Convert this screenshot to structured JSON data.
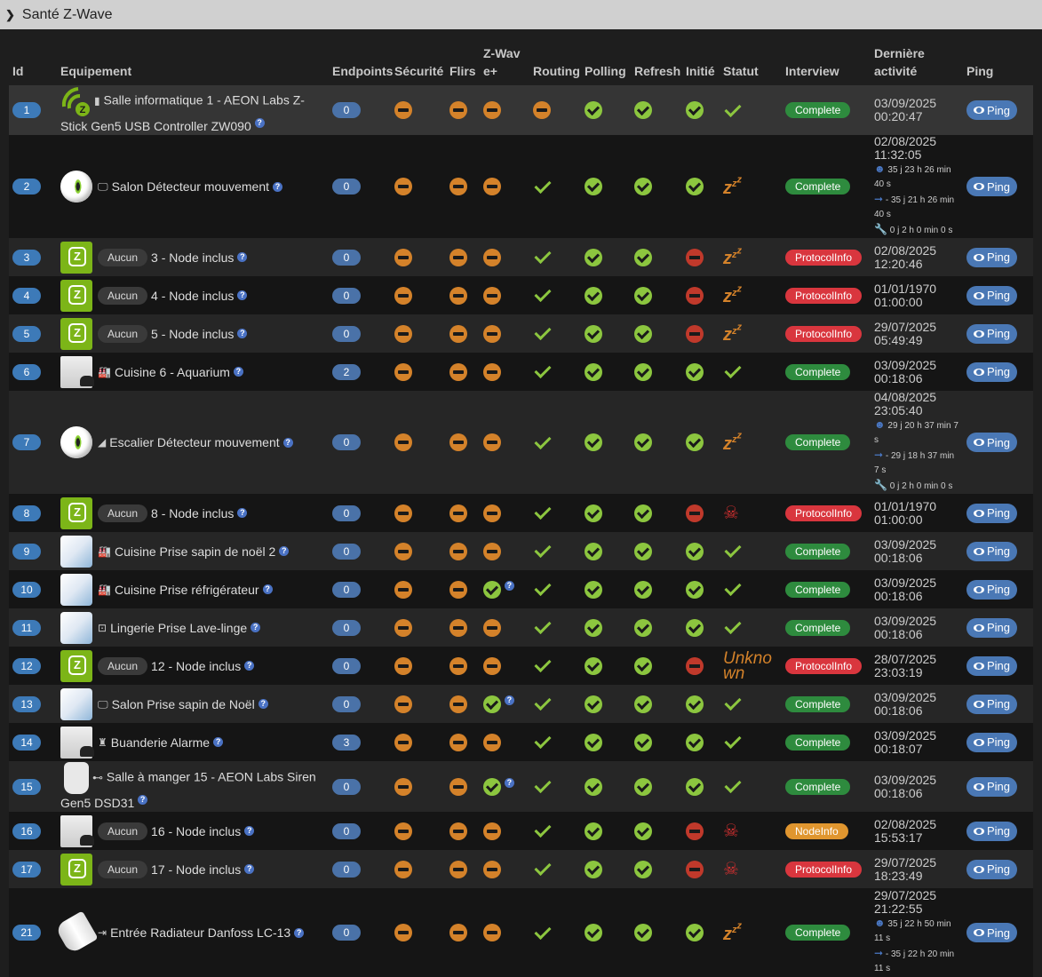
{
  "panel": {
    "title": "Santé Z-Wave"
  },
  "columns": [
    "Id",
    "Equipement",
    "Endpoints",
    "Sécurité",
    "Flirs",
    "Z-Wave+",
    "Routing",
    "Polling",
    "Refresh",
    "Initié",
    "Statut",
    "Interview",
    "Dernière activité",
    "Ping"
  ],
  "aucun_label": "Aucun",
  "ping_label": "Ping",
  "help_glyph": "?",
  "colors": {
    "ok": "#8cc63f",
    "warn": "#d4822a",
    "error": "#c0392b",
    "complete": "#2e8b3e",
    "protocolinfo": "#d9363e",
    "nodeinfo": "#e0962f",
    "ping": "#4a78b5"
  },
  "rows": [
    {
      "id": "1",
      "device": "zwave-stick",
      "room_icon": "▮",
      "name": "Salle informatique 1 - AEON Labs Z-Stick Gen5 USB Controller ZW090",
      "endpoints": "0",
      "security": "minus",
      "flirs": "minus",
      "zwaveplus": "minus",
      "routing": "minus",
      "polling": "ok",
      "refresh": "ok",
      "init": "ok",
      "status": "check",
      "interview": "Complete",
      "date": "03/09/2025",
      "time": "00:20:47"
    },
    {
      "id": "2",
      "device": "eye",
      "room_icon": "🖵",
      "name": "Salon Détecteur mouvement",
      "endpoints": "0",
      "security": "minus",
      "flirs": "minus",
      "zwaveplus": "minus",
      "routing": "check",
      "polling": "ok",
      "refresh": "ok",
      "init": "ok",
      "status": "sleep",
      "interview": "Complete",
      "date": "02/08/2025",
      "time": "11:32:05",
      "wakeup": "35 j 23 h 26 min 40 s",
      "next": "- 35 j 21 h 26 min 40 s",
      "interval": "0 j 2 h 0 min 0 s"
    },
    {
      "id": "3",
      "device": "zwave",
      "aucun": true,
      "name": "3 - Node inclus",
      "endpoints": "0",
      "security": "minus",
      "flirs": "minus",
      "zwaveplus": "minus",
      "routing": "check",
      "polling": "ok",
      "refresh": "ok",
      "init": "error",
      "status": "sleep",
      "interview": "ProtocolInfo",
      "date": "02/08/2025",
      "time": "12:20:46"
    },
    {
      "id": "4",
      "device": "zwave",
      "aucun": true,
      "name": "4 - Node inclus",
      "endpoints": "0",
      "security": "minus",
      "flirs": "minus",
      "zwaveplus": "minus",
      "routing": "check",
      "polling": "ok",
      "refresh": "ok",
      "init": "error",
      "status": "sleep",
      "interview": "ProtocolInfo",
      "date": "01/01/1970",
      "time": "01:00:00"
    },
    {
      "id": "5",
      "device": "zwave",
      "aucun": true,
      "name": "5 - Node inclus",
      "endpoints": "0",
      "security": "minus",
      "flirs": "minus",
      "zwaveplus": "minus",
      "routing": "check",
      "polling": "ok",
      "refresh": "ok",
      "init": "error",
      "status": "sleep",
      "interview": "ProtocolInfo",
      "date": "29/07/2025",
      "time": "05:49:49"
    },
    {
      "id": "6",
      "device": "box",
      "room_icon": "🏭",
      "name": "Cuisine 6 - Aquarium",
      "endpoints": "2",
      "security": "minus",
      "flirs": "minus",
      "zwaveplus": "minus",
      "routing": "check",
      "polling": "ok",
      "refresh": "ok",
      "init": "ok",
      "status": "check",
      "interview": "Complete",
      "date": "03/09/2025",
      "time": "00:18:06"
    },
    {
      "id": "7",
      "device": "eye",
      "room_icon": "◢",
      "name": "Escalier Détecteur mouvement",
      "endpoints": "0",
      "security": "minus",
      "flirs": "minus",
      "zwaveplus": "minus",
      "routing": "check",
      "polling": "ok",
      "refresh": "ok",
      "init": "ok",
      "status": "sleep",
      "interview": "Complete",
      "date": "04/08/2025",
      "time": "23:05:40",
      "wakeup": "29 j 20 h 37 min 7 s",
      "next": "- 29 j 18 h 37 min 7 s",
      "interval": "0 j 2 h 0 min 0 s"
    },
    {
      "id": "8",
      "device": "zwave",
      "aucun": true,
      "name": "8 - Node inclus",
      "endpoints": "0",
      "security": "minus",
      "flirs": "minus",
      "zwaveplus": "minus",
      "routing": "check",
      "polling": "ok",
      "refresh": "ok",
      "init": "error",
      "status": "dead",
      "interview": "ProtocolInfo",
      "date": "01/01/1970",
      "time": "01:00:00"
    },
    {
      "id": "9",
      "device": "plug",
      "room_icon": "🏭",
      "name": "Cuisine Prise sapin de noël 2",
      "endpoints": "0",
      "security": "minus",
      "flirs": "minus",
      "zwaveplus": "minus",
      "routing": "check",
      "polling": "ok",
      "refresh": "ok",
      "init": "ok",
      "status": "check",
      "interview": "Complete",
      "date": "03/09/2025",
      "time": "00:18:06"
    },
    {
      "id": "10",
      "device": "plug",
      "room_icon": "🏭",
      "name": "Cuisine Prise réfrigérateur",
      "endpoints": "0",
      "security": "minus",
      "flirs": "minus",
      "zwaveplus": "ok-help",
      "routing": "check",
      "polling": "ok",
      "refresh": "ok",
      "init": "ok",
      "status": "check",
      "interview": "Complete",
      "date": "03/09/2025",
      "time": "00:18:06"
    },
    {
      "id": "11",
      "device": "plug",
      "room_icon": "⊡",
      "name": "Lingerie Prise Lave-linge",
      "endpoints": "0",
      "security": "minus",
      "flirs": "minus",
      "zwaveplus": "minus",
      "routing": "check",
      "polling": "ok",
      "refresh": "ok",
      "init": "ok",
      "status": "check",
      "interview": "Complete",
      "date": "03/09/2025",
      "time": "00:18:06"
    },
    {
      "id": "12",
      "device": "zwave",
      "aucun": true,
      "name": "12 - Node inclus",
      "endpoints": "0",
      "security": "minus",
      "flirs": "minus",
      "zwaveplus": "minus",
      "routing": "check",
      "polling": "ok",
      "refresh": "ok",
      "init": "error",
      "status": "unknown",
      "status_text": "Unknown",
      "interview": "ProtocolInfo",
      "date": "28/07/2025",
      "time": "23:03:19"
    },
    {
      "id": "13",
      "device": "plug",
      "room_icon": "🖵",
      "name": "Salon Prise sapin de Noël",
      "endpoints": "0",
      "security": "minus",
      "flirs": "minus",
      "zwaveplus": "ok-help",
      "routing": "check",
      "polling": "ok",
      "refresh": "ok",
      "init": "ok",
      "status": "check",
      "interview": "Complete",
      "date": "03/09/2025",
      "time": "00:18:06"
    },
    {
      "id": "14",
      "device": "box",
      "room_icon": "♜",
      "name": "Buanderie Alarme",
      "endpoints": "3",
      "security": "minus",
      "flirs": "minus",
      "zwaveplus": "minus",
      "routing": "check",
      "polling": "ok",
      "refresh": "ok",
      "init": "ok",
      "status": "check",
      "interview": "Complete",
      "date": "03/09/2025",
      "time": "00:18:07"
    },
    {
      "id": "15",
      "device": "siren",
      "room_icon": "⊷",
      "name": "Salle à manger 15 - AEON Labs Siren Gen5 DSD31",
      "endpoints": "0",
      "security": "minus",
      "flirs": "minus",
      "zwaveplus": "ok-help",
      "routing": "check",
      "polling": "ok",
      "refresh": "ok",
      "init": "ok",
      "status": "check",
      "interview": "Complete",
      "date": "03/09/2025",
      "time": "00:18:06"
    },
    {
      "id": "16",
      "device": "box",
      "aucun": true,
      "name": "16 - Node inclus",
      "endpoints": "0",
      "security": "minus",
      "flirs": "minus",
      "zwaveplus": "minus",
      "routing": "check",
      "polling": "ok",
      "refresh": "ok",
      "init": "error",
      "status": "dead",
      "interview": "NodeInfo",
      "date": "02/08/2025",
      "time": "15:53:17"
    },
    {
      "id": "17",
      "device": "zwave",
      "aucun": true,
      "name": "17 - Node inclus",
      "endpoints": "0",
      "security": "minus",
      "flirs": "minus",
      "zwaveplus": "minus",
      "routing": "check",
      "polling": "ok",
      "refresh": "ok",
      "init": "error",
      "status": "dead",
      "interview": "ProtocolInfo",
      "date": "29/07/2025",
      "time": "18:23:49"
    },
    {
      "id": "21",
      "device": "valve",
      "room_icon": "⇥",
      "name": "Entrée Radiateur Danfoss LC-13",
      "endpoints": "0",
      "security": "minus",
      "flirs": "minus",
      "zwaveplus": "minus",
      "routing": "check",
      "polling": "ok",
      "refresh": "ok",
      "init": "ok",
      "status": "sleep",
      "interview": "Complete",
      "date": "29/07/2025",
      "time": "21:22:55",
      "wakeup": "35 j 22 h 50 min 11 s",
      "next": "- 35 j 22 h 20 min 11 s"
    }
  ]
}
